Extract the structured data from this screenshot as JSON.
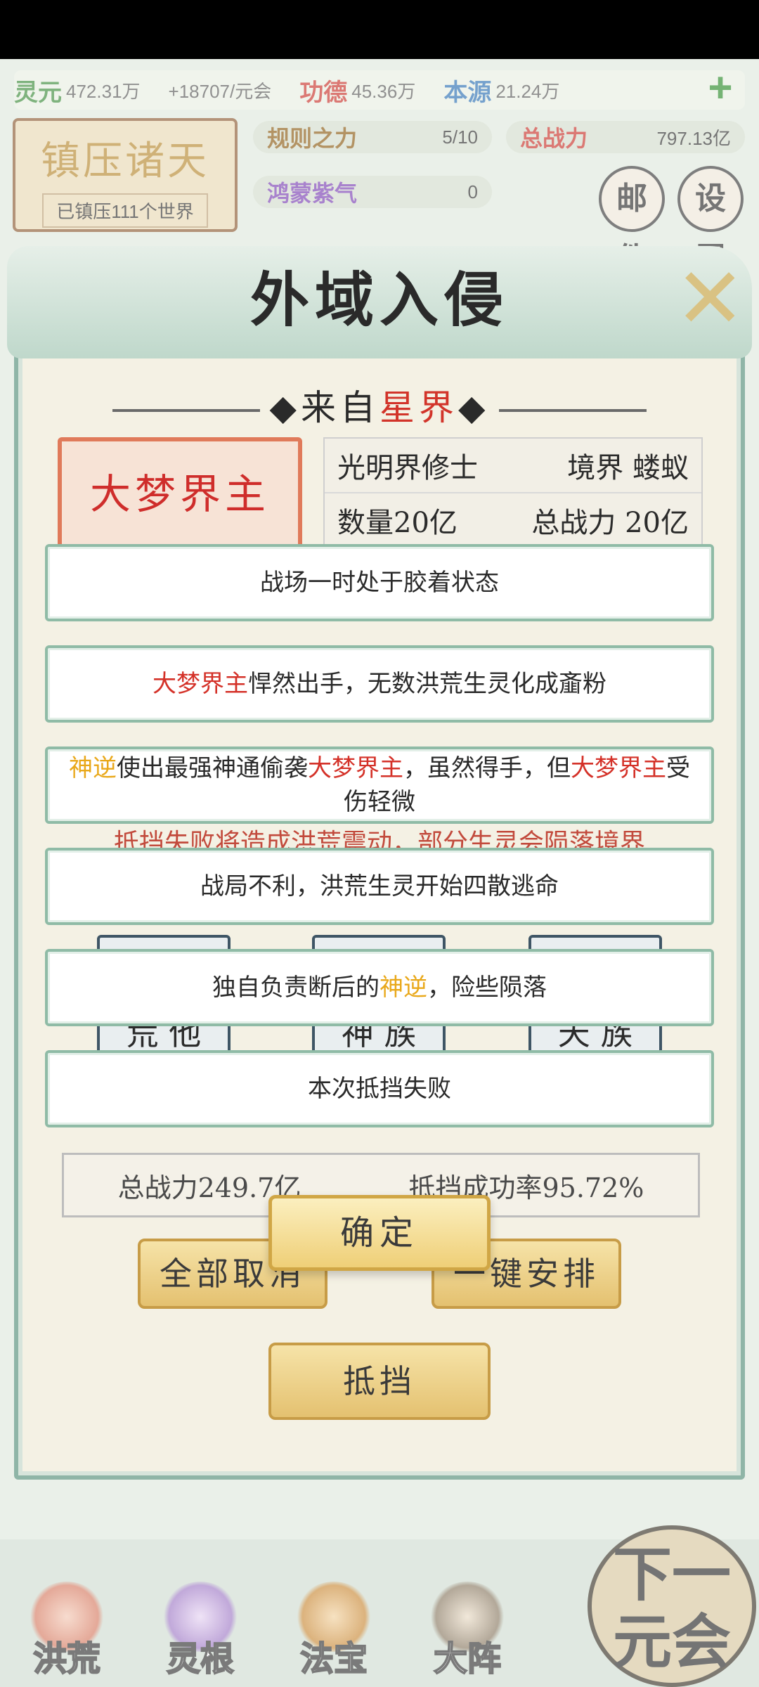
{
  "resources": {
    "lingyuan_label": "灵元",
    "lingyuan_value": "472.31万",
    "rate": "+18707/元会",
    "gongde_label": "功德",
    "gongde_value": "45.36万",
    "benyuan_label": "本源",
    "benyuan_value": "21.24万"
  },
  "plaque": {
    "title": "镇压诸天",
    "subtitle": "已镇压111个世界"
  },
  "stats": {
    "rule_label": "规则之力",
    "rule_value": "5/10",
    "power_label": "总战力",
    "power_value": "797.13亿",
    "purple_label": "鸿蒙紫气",
    "purple_value": "0"
  },
  "side_buttons": {
    "mail": "邮件",
    "settings": "设置"
  },
  "modal": {
    "title": "外域入侵",
    "close": "✕",
    "from_prefix": "来自",
    "from_place": "星界",
    "boss_name": "大梦界主",
    "info": [
      {
        "left": "光明界修士",
        "right": "境界 蝼蚁"
      },
      {
        "left": "数量20亿",
        "right": "总战力 20亿"
      }
    ],
    "hidden_note": "抵挡失败将造成洪荒震动，部分生灵会陨落境界",
    "team_slots": [
      "荒 他",
      "神 族",
      "天 族"
    ],
    "summary_power": "总战力249.7亿",
    "summary_rate": "抵挡成功率95.72%",
    "btn_cancel_all": "全部取消",
    "btn_auto": "一键安排",
    "btn_block": "抵挡",
    "btn_confirm": "确定"
  },
  "messages": [
    {
      "parts": [
        {
          "t": "战场一时处于胶着状态",
          "c": ""
        }
      ]
    },
    {
      "parts": [
        {
          "t": "大梦界主",
          "c": "red"
        },
        {
          "t": "悍然出手，无数洪荒生灵化成齑粉",
          "c": ""
        }
      ]
    },
    {
      "parts": [
        {
          "t": "神逆",
          "c": "gold"
        },
        {
          "t": "使出最强神通偷袭",
          "c": ""
        },
        {
          "t": "大梦界主",
          "c": "red"
        },
        {
          "t": "，虽然得手，但",
          "c": ""
        },
        {
          "t": "大梦界主",
          "c": "red"
        },
        {
          "t": "受伤轻微",
          "c": ""
        }
      ]
    },
    {
      "parts": [
        {
          "t": "战局不利，洪荒生灵开始四散逃命",
          "c": ""
        }
      ]
    },
    {
      "parts": [
        {
          "t": "独自负责断后的",
          "c": ""
        },
        {
          "t": "神逆",
          "c": "gold"
        },
        {
          "t": "，险些陨落",
          "c": ""
        }
      ]
    },
    {
      "parts": [
        {
          "t": "本次抵挡失败",
          "c": ""
        }
      ]
    }
  ],
  "bottom_nav": [
    "洪荒",
    "灵根",
    "法宝",
    "大阵"
  ],
  "next_button": "下一元会"
}
